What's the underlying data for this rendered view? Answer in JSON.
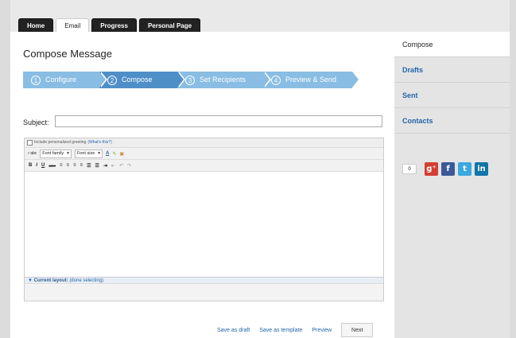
{
  "tabs": [
    "Home",
    "Email",
    "Progress",
    "Personal Page"
  ],
  "page_title": "Compose Message",
  "steps": [
    {
      "num": "1",
      "label": "Configure"
    },
    {
      "num": "2",
      "label": "Compose"
    },
    {
      "num": "3",
      "label": "Set Recipients"
    },
    {
      "num": "4",
      "label": "Preview & Send"
    }
  ],
  "subject": {
    "label": "Subject:",
    "value": ""
  },
  "greeting": {
    "label": "Include personalized greeting",
    "link": "(What's this?)"
  },
  "toolbar": {
    "font_family": "Font family",
    "font_size": "Font size"
  },
  "layout_bar": {
    "label": "Current layout:",
    "link": "(done selecting)"
  },
  "actions": {
    "save_draft": "Save as draft",
    "save_template": "Save as template",
    "preview": "Preview",
    "next": "Next"
  },
  "sidebar": [
    {
      "label": "Compose"
    },
    {
      "label": "Drafts"
    },
    {
      "label": "Sent"
    },
    {
      "label": "Contacts"
    }
  ],
  "social": {
    "count": "0"
  },
  "colors": {
    "step_active": "#4f8fc8",
    "step_inactive": "#89bde3",
    "link": "#2266aa",
    "gplus": "#d23f31",
    "facebook": "#3b5998",
    "twitter": "#3aa9e0",
    "linkedin": "#0e76a8"
  }
}
